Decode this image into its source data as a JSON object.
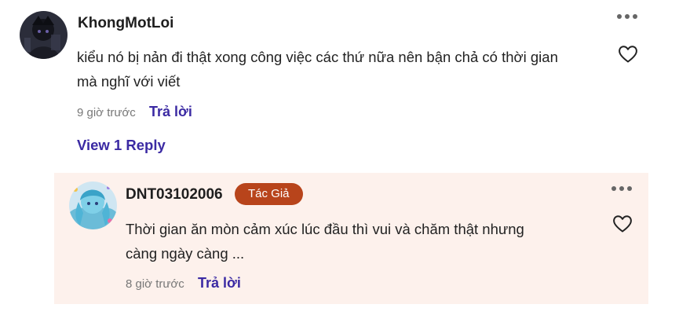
{
  "comment": {
    "username": "KhongMotLoi",
    "text_line1": "kiểu nó bị nản đi thật xong công việc các thứ nữa nên bận chả có thời gian",
    "text_line2": "mà nghĩ với viết",
    "time": "9 giờ trước",
    "reply_label": "Trả lời",
    "avatar_icon": "dark-anime-avatar",
    "more_icon": "more-horizontal-icon",
    "like_icon": "heart-outline-icon"
  },
  "view_replies_label": "View 1 Reply",
  "reply": {
    "username": "DNT03102006",
    "badge": "Tác Giả",
    "text_line1": "Thời gian ăn mòn cảm xúc lúc đầu thì vui và chăm thật nhưng",
    "text_line2": "càng ngày càng ...",
    "time": "8 giờ trước",
    "reply_label": "Trả lời",
    "avatar_icon": "blue-anime-avatar",
    "more_icon": "more-horizontal-icon",
    "like_icon": "heart-outline-icon"
  },
  "colors": {
    "link": "#3b2aa3",
    "badge_bg": "#b8441b",
    "reply_bg": "#fdf1ec",
    "muted": "#777777"
  }
}
